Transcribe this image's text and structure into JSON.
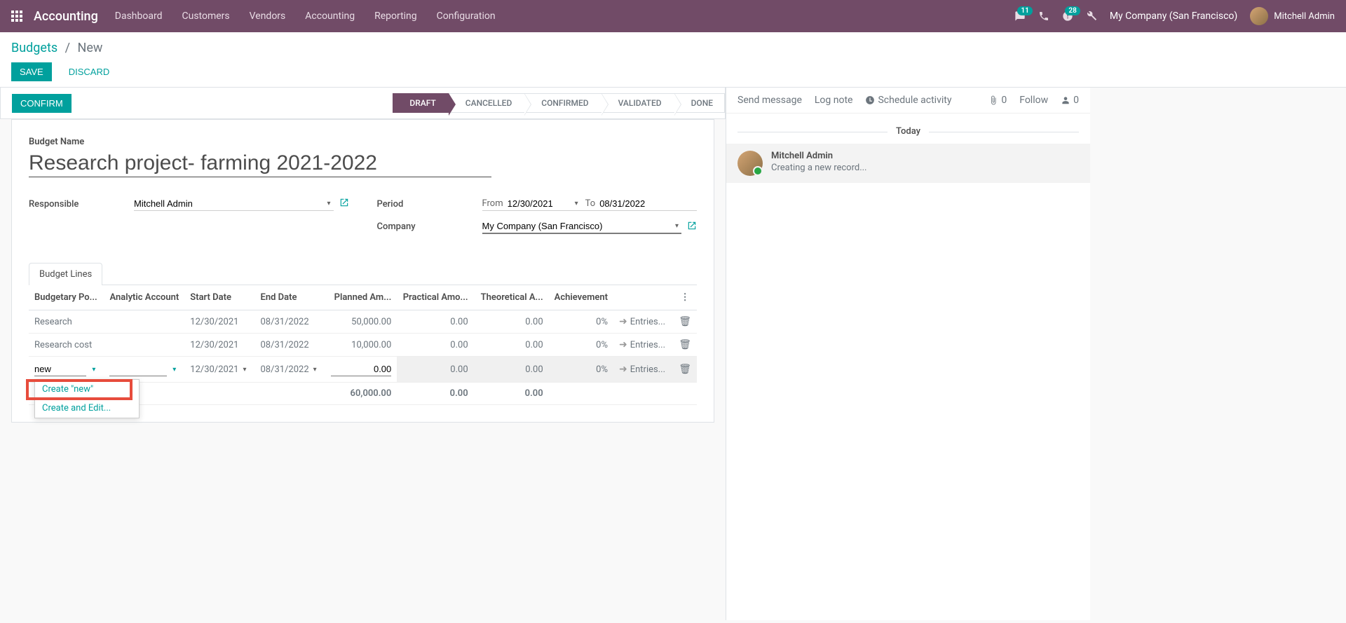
{
  "brand": "Accounting",
  "nav": {
    "items": [
      "Dashboard",
      "Customers",
      "Vendors",
      "Accounting",
      "Reporting",
      "Configuration"
    ]
  },
  "topbar": {
    "msg_badge": "11",
    "activity_badge": "28",
    "company": "My Company (San Francisco)",
    "user": "Mitchell Admin"
  },
  "breadcrumb": {
    "root": "Budgets",
    "current": "New"
  },
  "buttons": {
    "save": "SAVE",
    "discard": "DISCARD",
    "confirm": "CONFIRM"
  },
  "stages": [
    "DRAFT",
    "CANCELLED",
    "CONFIRMED",
    "VALIDATED",
    "DONE"
  ],
  "form": {
    "title_label": "Budget Name",
    "title_value": "Research project- farming 2021-2022",
    "responsible_label": "Responsible",
    "responsible_value": "Mitchell Admin",
    "period_label": "Period",
    "period_from_label": "From",
    "period_from": "12/30/2021",
    "period_to_label": "To",
    "period_to": "08/31/2022",
    "company_label": "Company",
    "company_value": "My Company (San Francisco)"
  },
  "tab": {
    "lines": "Budget Lines"
  },
  "columns": {
    "budgetary": "Budgetary Po...",
    "analytic": "Analytic Account",
    "start": "Start Date",
    "end": "End Date",
    "planned": "Planned Am...",
    "practical": "Practical Amo...",
    "theoretical": "Theoretical A...",
    "achievement": "Achievement"
  },
  "rows": [
    {
      "budgetary": "Research",
      "analytic": "",
      "start": "12/30/2021",
      "end": "08/31/2022",
      "planned": "50,000.00",
      "practical": "0.00",
      "theoretical": "0.00",
      "achievement": "0%",
      "entries": "Entries..."
    },
    {
      "budgetary": "Research cost",
      "analytic": "",
      "start": "12/30/2021",
      "end": "08/31/2022",
      "planned": "10,000.00",
      "practical": "0.00",
      "theoretical": "0.00",
      "achievement": "0%",
      "entries": "Entries..."
    }
  ],
  "editRow": {
    "budgetary": "new",
    "analytic": "",
    "start": "12/30/2021",
    "end": "08/31/2022",
    "planned": "0.00",
    "practical": "0.00",
    "theoretical": "0.00",
    "achievement": "0%",
    "entries": "Entries..."
  },
  "dropdown": {
    "create_new": "Create \"new\"",
    "create_edit": "Create and Edit..."
  },
  "totals": {
    "planned": "60,000.00",
    "practical": "0.00",
    "theoretical": "0.00"
  },
  "chatter": {
    "send": "Send message",
    "log": "Log note",
    "schedule": "Schedule activity",
    "attach_count": "0",
    "follow": "Follow",
    "follower_count": "0",
    "today": "Today",
    "author": "Mitchell Admin",
    "message": "Creating a new record..."
  }
}
